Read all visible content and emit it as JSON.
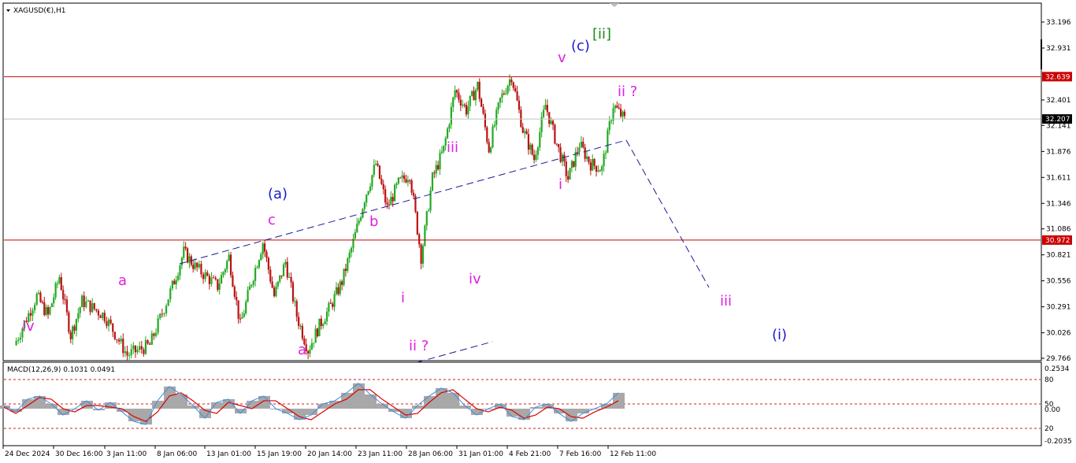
{
  "header": {
    "symbol_title": "XAGUSD(€),H1",
    "indicator_title": "MACD(12,26,9) 0.1031 0.0491"
  },
  "colors": {
    "bull": "#22aa22",
    "bear": "#bb1111",
    "hline": "#cc0000",
    "wave_magenta": "#e020e0",
    "wave_blue": "#1a1acc",
    "wave_green": "#1a8a1a",
    "trendline": "#1a1a99",
    "macd_hist": "#a8a8a8",
    "macd_signal": "#dd0000",
    "macd_main": "#3a8ee6",
    "current_price_bg": "#000000",
    "level_bg": "#cc0000"
  },
  "chart_data": [
    {
      "type": "candlestick",
      "title": "XAGUSD(€),H1",
      "ylim": [
        29.766,
        33.396
      ],
      "price_ticks": [
        "33.196",
        "32.931",
        "32.401",
        "32.141",
        "31.876",
        "31.611",
        "31.346",
        "31.086",
        "30.821",
        "30.556",
        "30.291",
        "30.026",
        "29.766"
      ],
      "x_tick_labels": [
        "24 Dec 2024",
        "30 Dec 16:00",
        "3 Jan 11:00",
        "8 Jan 06:00",
        "13 Jan 01:00",
        "15 Jan 19:00",
        "20 Jan 14:00",
        "23 Jan 11:00",
        "28 Jan 06:00",
        "31 Jan 01:00",
        "4 Feb 21:00",
        "7 Feb 16:00",
        "12 Feb 11:00"
      ],
      "horizontal_levels": [
        {
          "value": 32.639,
          "label": "32.639"
        },
        {
          "value": 30.972,
          "label": "30.972"
        }
      ],
      "current_price": {
        "value": 32.207,
        "label": "32.207"
      },
      "price_path": [
        [
          0,
          29.9
        ],
        [
          2,
          30.4
        ],
        [
          3,
          30.2
        ],
        [
          4,
          30.6
        ],
        [
          5,
          30.0
        ],
        [
          6,
          30.35
        ],
        [
          8,
          30.2
        ],
        [
          10,
          29.8
        ],
        [
          12,
          29.9
        ],
        [
          14,
          30.5
        ],
        [
          15,
          30.85
        ],
        [
          16,
          30.7
        ],
        [
          18,
          30.5
        ],
        [
          19,
          30.8
        ],
        [
          20,
          30.1
        ],
        [
          21,
          30.55
        ],
        [
          22,
          30.95
        ],
        [
          23,
          30.4
        ],
        [
          24,
          30.75
        ],
        [
          25,
          30.2
        ],
        [
          26,
          29.85
        ],
        [
          27,
          30.1
        ],
        [
          28,
          30.3
        ],
        [
          29,
          30.55
        ],
        [
          30,
          30.95
        ],
        [
          31,
          31.4
        ],
        [
          32,
          31.75
        ],
        [
          33,
          31.3
        ],
        [
          34,
          31.55
        ],
        [
          35,
          31.65
        ],
        [
          36,
          30.8
        ],
        [
          37,
          31.6
        ],
        [
          38,
          31.9
        ],
        [
          39,
          32.5
        ],
        [
          40,
          32.3
        ],
        [
          41,
          32.55
        ],
        [
          42,
          31.9
        ],
        [
          43,
          32.4
        ],
        [
          44,
          32.65
        ],
        [
          45,
          32.1
        ],
        [
          46,
          31.8
        ],
        [
          47,
          32.35
        ],
        [
          48,
          31.95
        ],
        [
          49,
          31.6
        ],
        [
          50,
          31.95
        ],
        [
          51,
          31.75
        ],
        [
          52,
          31.7
        ],
        [
          53,
          32.35
        ],
        [
          54,
          32.2
        ]
      ],
      "wave_labels": [
        {
          "text": "iv",
          "color": "magenta"
        },
        {
          "text": "a",
          "color": "magenta"
        },
        {
          "text": "c",
          "color": "magenta"
        },
        {
          "text": "(a)",
          "color": "blue"
        },
        {
          "text": "a",
          "color": "magenta"
        },
        {
          "text": "b",
          "color": "magenta"
        },
        {
          "text": "i",
          "color": "magenta"
        },
        {
          "text": "ii ?",
          "color": "magenta"
        },
        {
          "text": "iii",
          "color": "magenta"
        },
        {
          "text": "iv",
          "color": "magenta"
        },
        {
          "text": "v",
          "color": "magenta"
        },
        {
          "text": "(c)",
          "color": "blue"
        },
        {
          "text": "[ii]",
          "color": "green"
        },
        {
          "text": "i",
          "color": "magenta"
        },
        {
          "text": "ii ?",
          "color": "magenta"
        },
        {
          "text": "iii",
          "color": "magenta"
        },
        {
          "text": "(i)",
          "color": "blue"
        }
      ]
    },
    {
      "type": "line",
      "title": "MACD(12,26,9) 0.1031 0.0491",
      "ylim": [
        -0.2035,
        0.2534
      ],
      "y_tick_labels": [
        "0.2534",
        "80",
        "50",
        "0.00",
        "20",
        "-0.2035"
      ],
      "levels": [
        80,
        50,
        20
      ],
      "series": [
        {
          "name": "MACD",
          "values": [
            0.02,
            -0.02,
            0.06,
            0.08,
            0.03,
            -0.04,
            0.0,
            0.05,
            -0.01,
            0.04,
            -0.02,
            -0.08,
            -0.1,
            0.05,
            0.14,
            0.09,
            0.02,
            -0.06,
            0.04,
            0.06,
            -0.03,
            0.05,
            0.08,
            0.0,
            -0.03,
            -0.07,
            -0.04,
            0.03,
            0.05,
            0.1,
            0.16,
            0.09,
            0.03,
            -0.02,
            -0.06,
            0.02,
            0.08,
            0.13,
            0.1,
            0.02,
            -0.04,
            0.0,
            0.03,
            -0.05,
            -0.07,
            0.01,
            0.03,
            -0.03,
            -0.08,
            -0.03,
            0.0,
            0.03,
            0.1
          ]
        },
        {
          "name": "Signal",
          "values": [
            0.01,
            -0.03,
            0.02,
            0.07,
            0.06,
            0.0,
            -0.02,
            0.02,
            0.02,
            0.01,
            0.0,
            -0.05,
            -0.08,
            -0.02,
            0.08,
            0.1,
            0.05,
            -0.01,
            -0.03,
            0.04,
            0.02,
            0.0,
            0.05,
            0.05,
            0.0,
            -0.05,
            -0.07,
            -0.02,
            0.03,
            0.06,
            0.12,
            0.12,
            0.06,
            0.01,
            -0.04,
            -0.03,
            0.04,
            0.1,
            0.12,
            0.06,
            0.0,
            -0.02,
            0.01,
            -0.01,
            -0.06,
            -0.04,
            0.01,
            0.0,
            -0.05,
            -0.06,
            -0.02,
            0.01,
            0.05
          ]
        }
      ]
    }
  ]
}
